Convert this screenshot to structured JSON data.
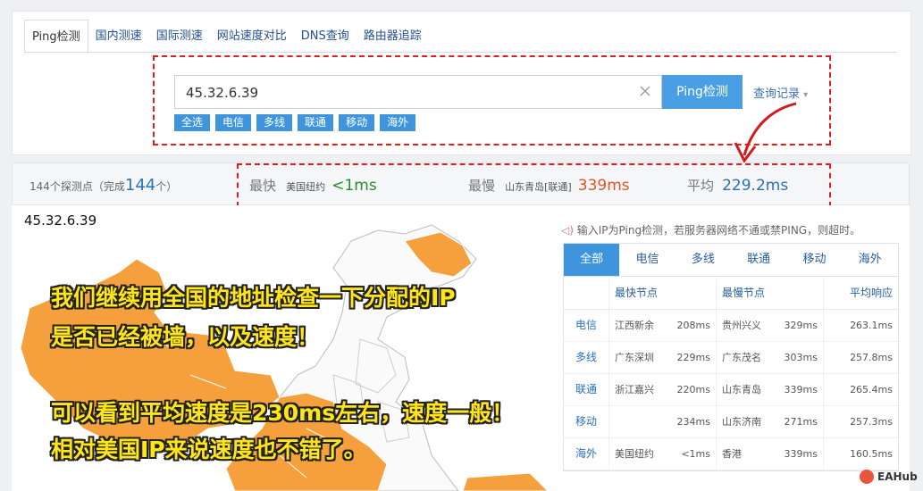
{
  "tabs": [
    "Ping检测",
    "国内测速",
    "国际测速",
    "网站速度对比",
    "DNS查询",
    "路由器追踪"
  ],
  "search": {
    "value": "45.32.6.39",
    "button": "Ping检测",
    "history": "查询记录"
  },
  "filters": [
    "全选",
    "电信",
    "多线",
    "联通",
    "移动",
    "海外"
  ],
  "summary": {
    "probe_prefix": "144个探测点（完成",
    "probe_count": "144",
    "probe_suffix": "个）",
    "fastest_label": "最快",
    "fastest_loc": "美国纽约",
    "fastest_val": "<1ms",
    "fastest_color": "#2a8a2a",
    "slowest_label": "最慢",
    "slowest_loc": "山东青岛[联通]",
    "slowest_val": "339ms",
    "slowest_color": "#e0522a",
    "avg_label": "平均",
    "avg_val": "229.2ms",
    "avg_color": "#2a6fb8"
  },
  "map": {
    "ip": "45.32.6.39",
    "fill": "#f5a03c"
  },
  "notice": "输入IP为Ping检测，若服务器网络不通或禁PING，则超时。",
  "results": {
    "tabs": [
      "全部",
      "电信",
      "多线",
      "联通",
      "移动",
      "海外"
    ],
    "headers": {
      "fast": "最快节点",
      "slow": "最慢节点",
      "avg": "平均响应"
    },
    "rows": [
      {
        "isp": "电信",
        "fast_loc": "江西新余",
        "fast_val": "208ms",
        "slow_loc": "贵州兴义",
        "slow_val": "329ms",
        "avg": "263.1ms"
      },
      {
        "isp": "多线",
        "fast_loc": "广东深圳",
        "fast_val": "229ms",
        "slow_loc": "广东茂名",
        "slow_val": "303ms",
        "avg": "257.8ms"
      },
      {
        "isp": "联通",
        "fast_loc": "浙江嘉兴",
        "fast_val": "220ms",
        "slow_loc": "山东青岛",
        "slow_val": "339ms",
        "avg": "265.4ms"
      },
      {
        "isp": "移动",
        "fast_loc": "",
        "fast_val": "234ms",
        "slow_loc": "山东济南",
        "slow_val": "271ms",
        "avg": "257.3ms"
      },
      {
        "isp": "海外",
        "fast_loc": "美国纽约",
        "fast_val": "<1ms",
        "slow_loc": "香港",
        "slow_val": "339ms",
        "avg": "160.5ms"
      }
    ]
  },
  "caption": {
    "line1": "我们继续用全国的地址检查一下分配的IP",
    "line2": "是否已经被墙，以及速度！",
    "line3": "可以看到平均速度是230ms左右，速度一般！",
    "line4": "相对美国IP来说速度也不错了。"
  },
  "watermark": "EAHub"
}
